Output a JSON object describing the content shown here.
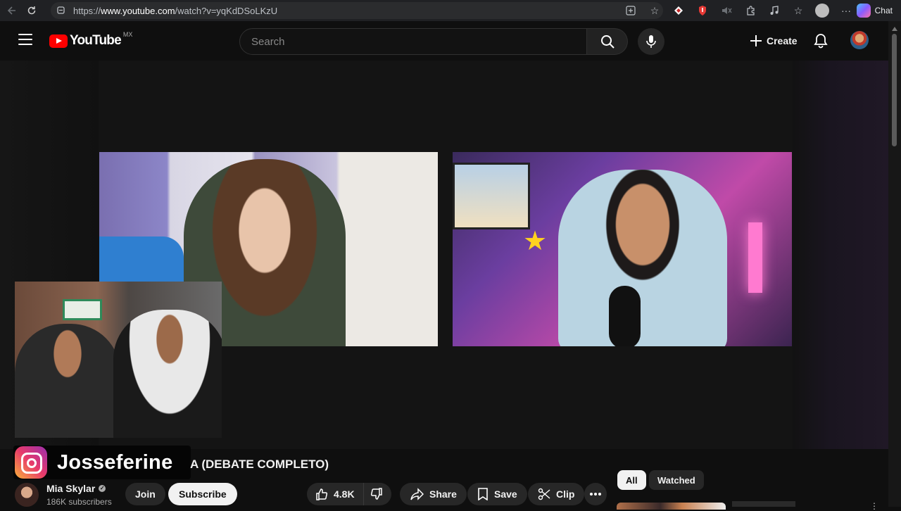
{
  "browser": {
    "url_prefix": "https://",
    "url_host": "www.youtube.com",
    "url_path": "/watch?v=yqKdDSoLKzU",
    "chat_label": "Chat",
    "icons": [
      "back-icon",
      "refresh-icon",
      "url-info-icon",
      "apps-icon",
      "favorite-icon",
      "extension-diamond-icon",
      "extension-red-icon",
      "mute-icon",
      "extensions-icon",
      "music-icon",
      "collections-icon",
      "profile-icon",
      "more-icon"
    ]
  },
  "header": {
    "logo_text": "YouTube",
    "region": "MX",
    "search_placeholder": "Search",
    "create_label": "Create"
  },
  "player": {
    "instagram_handle": "Josseferine"
  },
  "video": {
    "title_visible": "A (DEBATE COMPLETO)",
    "channel_name": "Mia Skylar",
    "subscribers": "186K subscribers",
    "join_label": "Join",
    "subscribe_label": "Subscribe",
    "likes": "4.8K",
    "share_label": "Share",
    "save_label": "Save",
    "clip_label": "Clip"
  },
  "sidebar_filters": {
    "chips": [
      "All",
      "Watched"
    ]
  },
  "colors": {
    "brand_red": "#ff0000",
    "background": "#0f0f0f",
    "chip_selected": "#f1f1f1"
  }
}
